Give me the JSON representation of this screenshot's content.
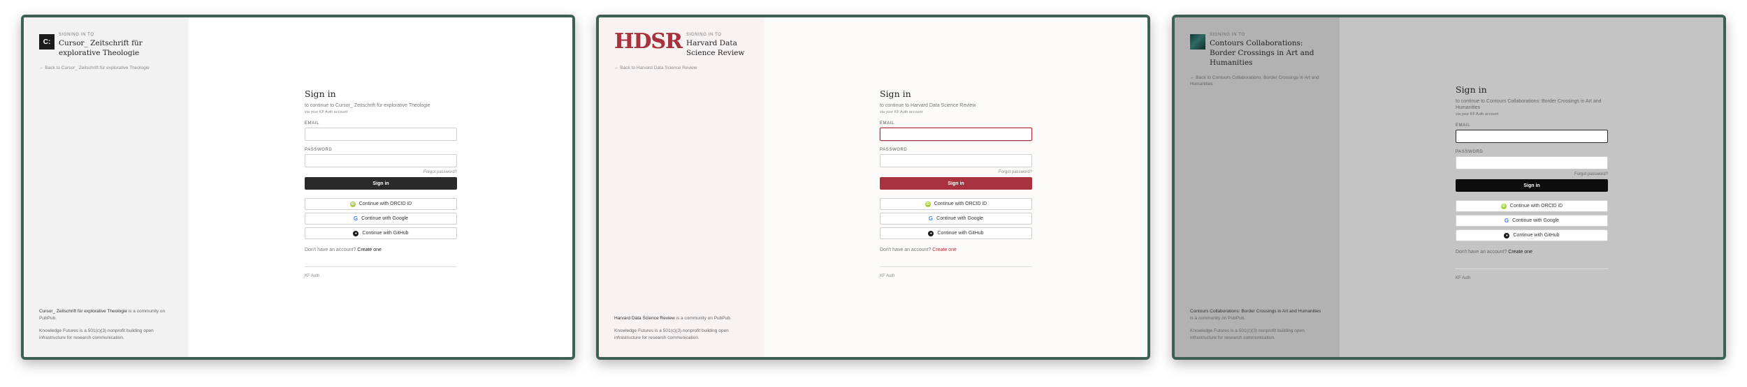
{
  "common": {
    "signing_in_to": "SIGNING IN TO",
    "sign_in_heading": "Sign in",
    "via_account": "via your KF Auth account",
    "email_label": "EMAIL",
    "password_label": "PASSWORD",
    "forgot": "Forgot password?",
    "sign_in_button": "Sign in",
    "orcid": "Continue with ORCID iD",
    "google": "Continue with Google",
    "github": "Continue with GitHub",
    "no_account": "Don't have an account?",
    "create": "Create one",
    "kf_auth": "KF Auth",
    "kf_note": "Knowledge Futures is a 501(c)(3) nonprofit building open infrastructure for research communication.",
    "community_on": "is a community on PubPub."
  },
  "panels": [
    {
      "community": "Cursor_ Zeitschrift für explorative Theologie",
      "logo_text": "C:",
      "back": "← Back to Cursor_ Zeitschrift für explorative Theologie",
      "continue_to": "to continue to Cursor_ Zeitschrift für explorative Theologie",
      "accent": "#2a2a2a"
    },
    {
      "community": "Harvard Data Science Review",
      "logo_text": "HDSR",
      "back": "← Back to Harvard Data Science Review",
      "continue_to": "to continue to Harvard Data Science Review",
      "accent": "#a8323e"
    },
    {
      "community": "Contours Collaborations: Border Crossings in Art and Humanities",
      "logo_text": "",
      "back": "← Back to Contours Collaborations: Border Crossings in Art and Humanities",
      "continue_to": "to continue to Contours Collaborations: Border Crossings in Art and Humanities",
      "accent": "#0d0d0d"
    }
  ]
}
